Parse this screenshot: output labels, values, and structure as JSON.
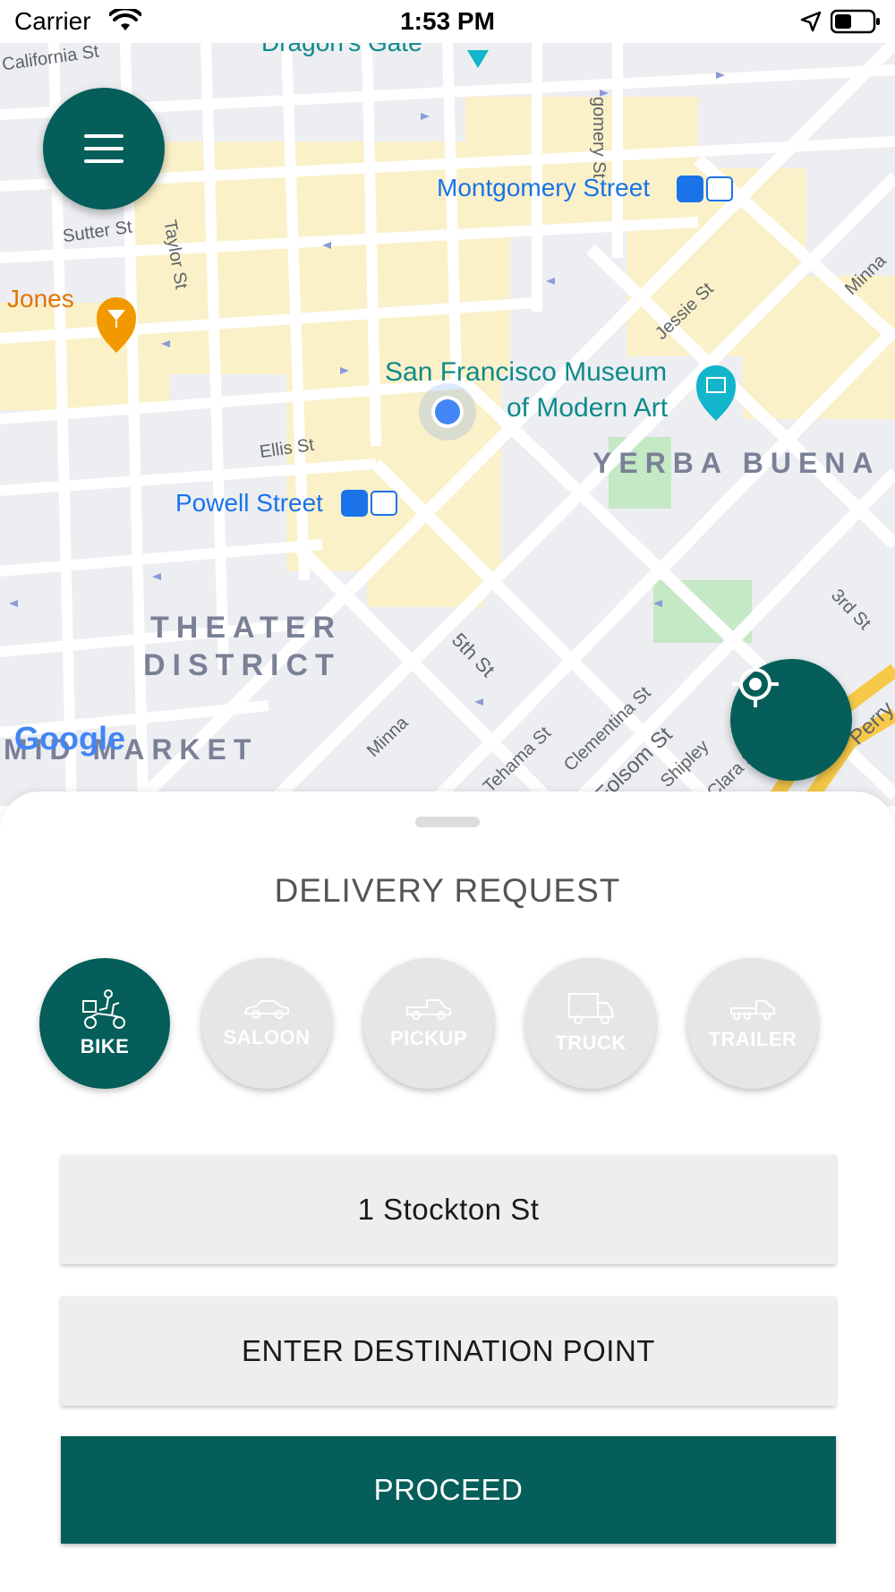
{
  "status_bar": {
    "carrier": "Carrier",
    "time": "1:53 PM"
  },
  "map": {
    "labels": {
      "california_st": "California St",
      "dragons_gate": "Dragon's Gate",
      "montgomery_st": "gomery St",
      "montgomery_station": "Montgomery Street",
      "sutter_st": "Sutter St",
      "taylor_st": "Taylor St",
      "jones": "Jones",
      "jessie_st": "Jessie St",
      "minna_top": "Minna",
      "sfmoma_line1": "San Francisco Museum",
      "sfmoma_line2": "of Modern Art",
      "yerba_buena": "YERBA BUENA",
      "ellis_st": "Ellis St",
      "powell_station": "Powell Street",
      "third_st": "3rd St",
      "theater_line1": "THEATER",
      "theater_line2": "DISTRICT",
      "fifth_st": "5th St",
      "minna_bottom": "Minna",
      "clementina_st": "Clementina St",
      "folsom_st": "Folsom St",
      "shipley": "Shipley",
      "clara_st": "Clara St",
      "perry": "Perry",
      "tehama_st": "Tehama St",
      "mid_market": "MID MARKET",
      "google": "Google"
    },
    "colors": {
      "water_poi": "#0f8a8a",
      "transit": "#1a73e8",
      "bar": "#e37400",
      "user_dot": "#4285f4"
    }
  },
  "buttons": {
    "menu_icon": "hamburger-menu-icon",
    "locate_icon": "crosshair-icon"
  },
  "sheet": {
    "title": "DELIVERY REQUEST",
    "vehicles": [
      {
        "label": "BIKE",
        "icon": "delivery-bike-icon",
        "selected": true
      },
      {
        "label": "SALOON",
        "icon": "saloon-car-icon",
        "selected": false
      },
      {
        "label": "PICKUP",
        "icon": "pickup-truck-icon",
        "selected": false
      },
      {
        "label": "TRUCK",
        "icon": "truck-icon",
        "selected": false
      },
      {
        "label": "TRAILER",
        "icon": "trailer-truck-icon",
        "selected": false
      }
    ],
    "pickup_value": "1 Stockton St",
    "destination_placeholder": "ENTER DESTINATION POINT",
    "proceed_label": "PROCEED"
  },
  "theme": {
    "primary": "#055e59",
    "inactive": "#e6e6e6"
  }
}
